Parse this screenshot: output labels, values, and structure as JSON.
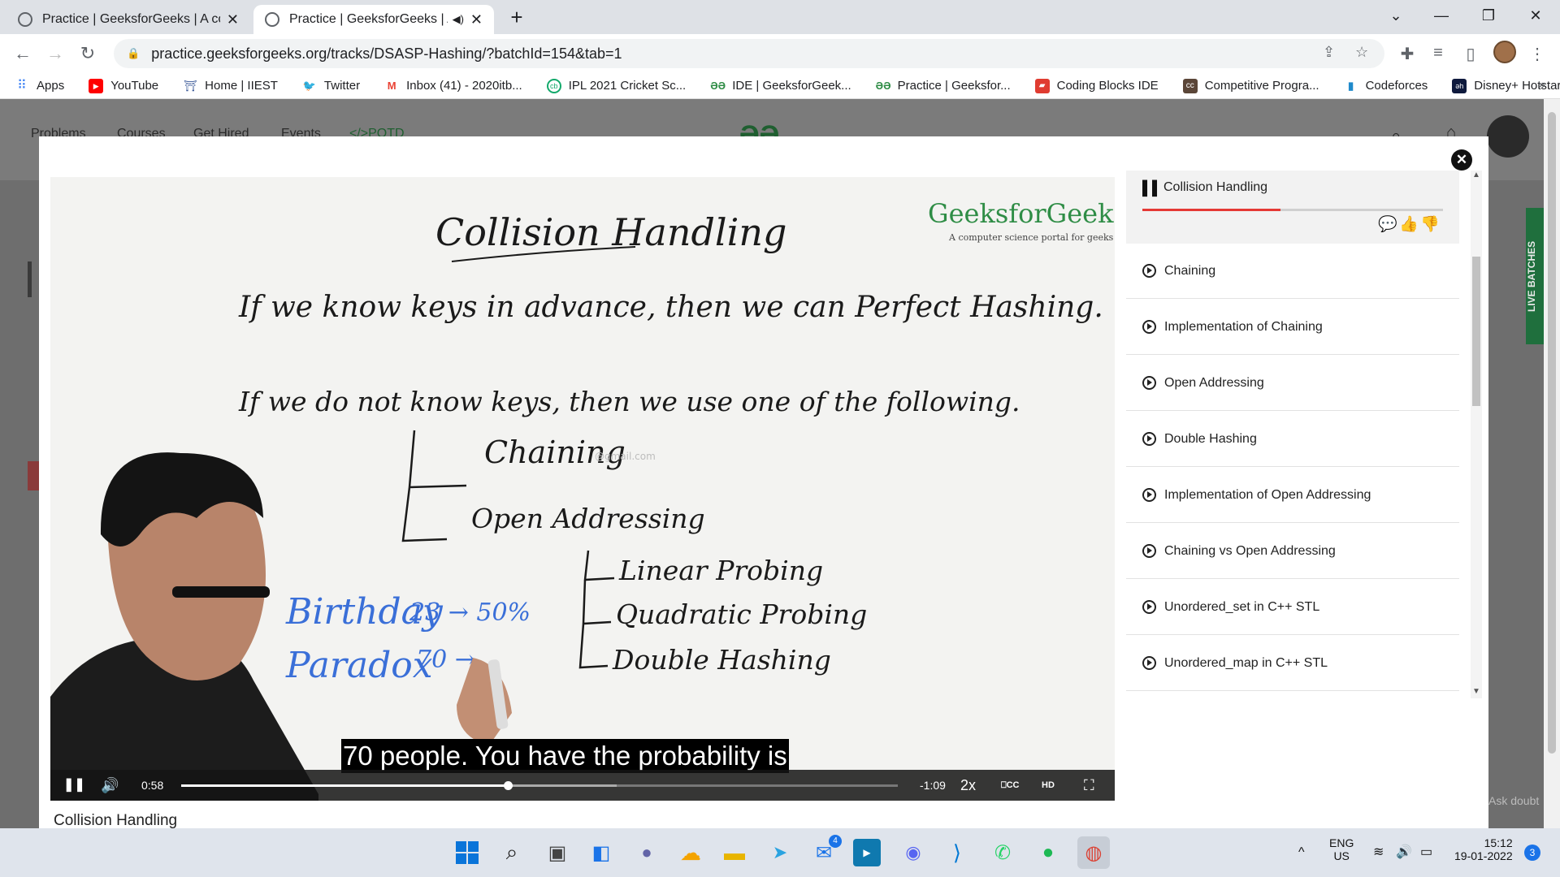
{
  "browser": {
    "tabs": [
      {
        "title": "Practice | GeeksforGeeks | A com",
        "active": false
      },
      {
        "title": "Practice | GeeksforGeeks | A",
        "active": true,
        "audio": true
      }
    ],
    "url": "practice.geeksforgeeks.org/tracks/DSASP-Hashing/?batchId=154&tab=1",
    "bookmarks": [
      {
        "label": "Apps",
        "icon": "apps-grid-icon",
        "color": "#4285f4"
      },
      {
        "label": "YouTube",
        "icon": "youtube-icon",
        "color": "#ff0000"
      },
      {
        "label": "Home | IIEST",
        "icon": "iiest-icon",
        "color": "#3b5998"
      },
      {
        "label": "Twitter",
        "icon": "twitter-icon",
        "color": "#1da1f2"
      },
      {
        "label": "Inbox (41) - 2020itb...",
        "icon": "gmail-icon",
        "color": "#ea4335"
      },
      {
        "label": "IPL 2021 Cricket Sc...",
        "icon": "cricbuzz-icon",
        "color": "#13a96b"
      },
      {
        "label": "IDE | GeeksforGeek...",
        "icon": "gfg-icon",
        "color": "#2f8d46"
      },
      {
        "label": "Practice | Geeksfor...",
        "icon": "gfg-icon",
        "color": "#2f8d46"
      },
      {
        "label": "Coding Blocks IDE",
        "icon": "codingblocks-icon",
        "color": "#e03c31"
      },
      {
        "label": "Competitive Progra...",
        "icon": "cc-icon",
        "color": "#5b4638"
      },
      {
        "label": "Codeforces",
        "icon": "codeforces-icon",
        "color": "#1f8acb"
      },
      {
        "label": "Disney+ Hotstar -...",
        "icon": "hotstar-icon",
        "color": "#0f1a3d"
      }
    ]
  },
  "page": {
    "nav": [
      "Problems",
      "Courses",
      "Get Hired",
      "Events",
      "</>POTD"
    ],
    "side_tab": "LIVE BATCHES",
    "ask_doubt": "Ask doubt"
  },
  "player": {
    "whiteboard": {
      "title": "Collision Handling",
      "brand": "GeeksforGeeks",
      "brand_tagline": "A computer science portal for geeks",
      "line1": "If we know keys in advance, then we can Perfect Hashing.",
      "line2": "If we do not know keys, then we use one of the following.",
      "branch1": "Chaining",
      "branch2": "Open Addressing",
      "sub1": "Linear Probing",
      "sub2": "Quadratic Probing",
      "sub3": "Double Hashing",
      "note1": "Birthday",
      "note2": "Paradox",
      "note3": "23 → 50%",
      "note4": "70 →",
      "watermark": "@gmail.com"
    },
    "subtitle": "70 people. You have the probability is",
    "elapsed": "0:58",
    "remaining": "-1:09",
    "speed": "2x",
    "progress_fraction": 0.456,
    "buffer_fraction": 0.608,
    "caption": "Collision Handling"
  },
  "playlist": {
    "current": "Collision Handling",
    "current_progress": 0.46,
    "items": [
      "Chaining",
      "Implementation of Chaining",
      "Open Addressing",
      "Double Hashing",
      "Implementation of Open Addressing",
      "Chaining vs Open Addressing",
      "Unordered_set in C++ STL",
      "Unordered_map in C++ STL"
    ]
  },
  "taskbar": {
    "lang": "ENG",
    "region": "US",
    "time": "15:12",
    "date": "19-01-2022",
    "notifications": "3",
    "mail_badge": "4"
  },
  "colors": {
    "gfg_green": "#2f8d46",
    "progress_red": "#e53935",
    "taskbar": "#dfe4ec"
  }
}
